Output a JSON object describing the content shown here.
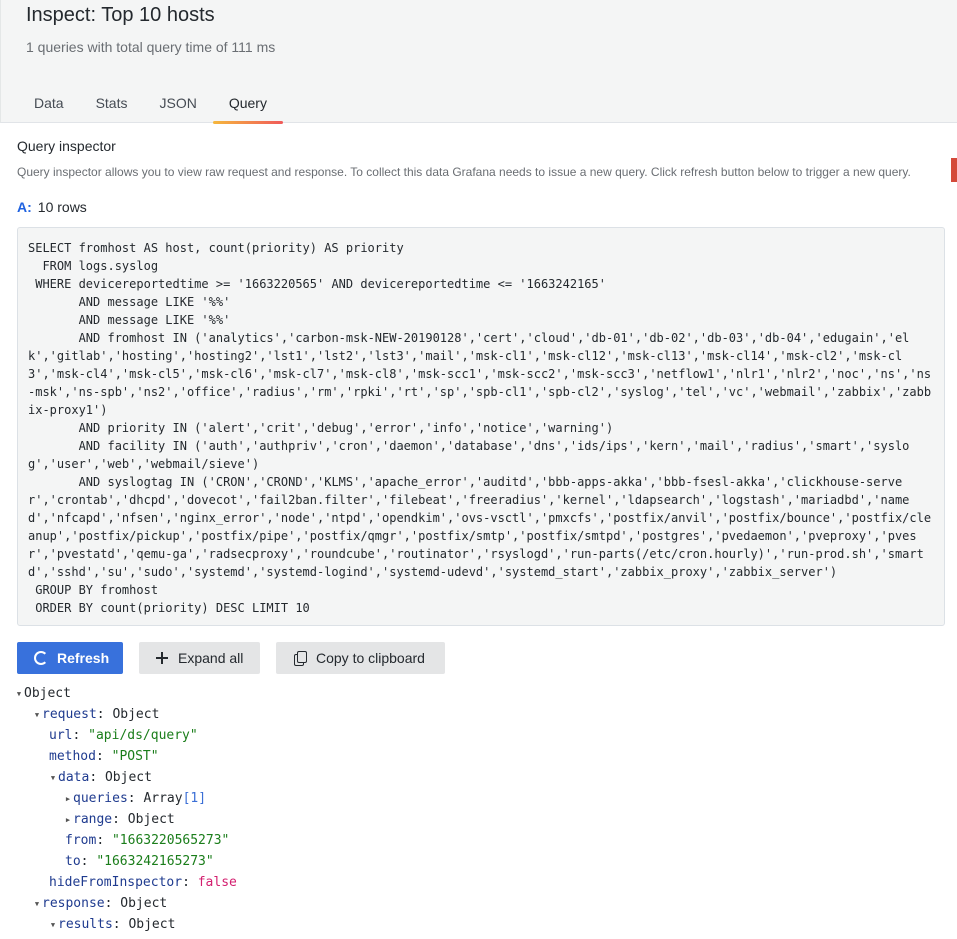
{
  "header": {
    "title": "Inspect: Top 10 hosts",
    "subtitle": "1 queries with total query time of 111 ms",
    "tabs": [
      {
        "label": "Data",
        "active": false
      },
      {
        "label": "Stats",
        "active": false
      },
      {
        "label": "JSON",
        "active": false
      },
      {
        "label": "Query",
        "active": true
      }
    ]
  },
  "inspector": {
    "title": "Query inspector",
    "description": "Query inspector allows you to view raw request and response. To collect this data Grafana needs to issue a new query. Click refresh button below to trigger a new query.",
    "query_ref": "A:",
    "rows_text": "10 rows",
    "sql": "SELECT fromhost AS host, count(priority) AS priority\n  FROM logs.syslog\n WHERE devicereportedtime >= '1663220565' AND devicereportedtime <= '1663242165'\n       AND message LIKE '%%'\n       AND message LIKE '%%'\n       AND fromhost IN ('analytics','carbon-msk-NEW-20190128','cert','cloud','db-01','db-02','db-03','db-04','edugain','elk','gitlab','hosting','hosting2','lst1','lst2','lst3','mail','msk-cl1','msk-cl12','msk-cl13','msk-cl14','msk-cl2','msk-cl3','msk-cl4','msk-cl5','msk-cl6','msk-cl7','msk-cl8','msk-scc1','msk-scc2','msk-scc3','netflow1','nlr1','nlr2','noc','ns','ns-msk','ns-spb','ns2','office','radius','rm','rpki','rt','sp','spb-cl1','spb-cl2','syslog','tel','vc','webmail','zabbix','zabbix-proxy1')\n       AND priority IN ('alert','crit','debug','error','info','notice','warning')\n       AND facility IN ('auth','authpriv','cron','daemon','database','dns','ids/ips','kern','mail','radius','smart','syslog','user','web','webmail/sieve')\n       AND syslogtag IN ('CRON','CROND','KLMS','apache_error','auditd','bbb-apps-akka','bbb-fsesl-akka','clickhouse-server','crontab','dhcpd','dovecot','fail2ban.filter','filebeat','freeradius','kernel','ldapsearch','logstash','mariadbd','named','nfcapd','nfsen','nginx_error','node','ntpd','opendkim','ovs-vsctl','pmxcfs','postfix/anvil','postfix/bounce','postfix/cleanup','postfix/pickup','postfix/pipe','postfix/qmgr','postfix/smtp','postfix/smtpd','postgres','pvedaemon','pveproxy','pvesr','pvestatd','qemu-ga','radsecproxy','roundcube','routinator','rsyslogd','run-parts(/etc/cron.hourly)','run-prod.sh','smartd','sshd','su','sudo','systemd','systemd-logind','systemd-udevd','systemd_start','zabbix_proxy','zabbix_server')\n GROUP BY fromhost\n ORDER BY count(priority) DESC LIMIT 10"
  },
  "buttons": {
    "refresh": "Refresh",
    "expand": "Expand all",
    "copy": "Copy to clipboard"
  },
  "tree": {
    "root": "Object",
    "request_key": "request",
    "request_type": "Object",
    "url_key": "url",
    "url_value": "\"api/ds/query\"",
    "method_key": "method",
    "method_value": "\"POST\"",
    "data_key": "data",
    "data_type": "Object",
    "queries_key": "queries",
    "queries_type": "Array",
    "queries_count": "[1]",
    "range_key": "range",
    "range_type": "Object",
    "from_key": "from",
    "from_value": "\"1663220565273\"",
    "to_key": "to",
    "to_value": "\"1663242165273\"",
    "hide_key": "hideFromInspector",
    "hide_value": "false",
    "response_key": "response",
    "response_type": "Object",
    "results_key": "results",
    "results_type": "Object"
  }
}
